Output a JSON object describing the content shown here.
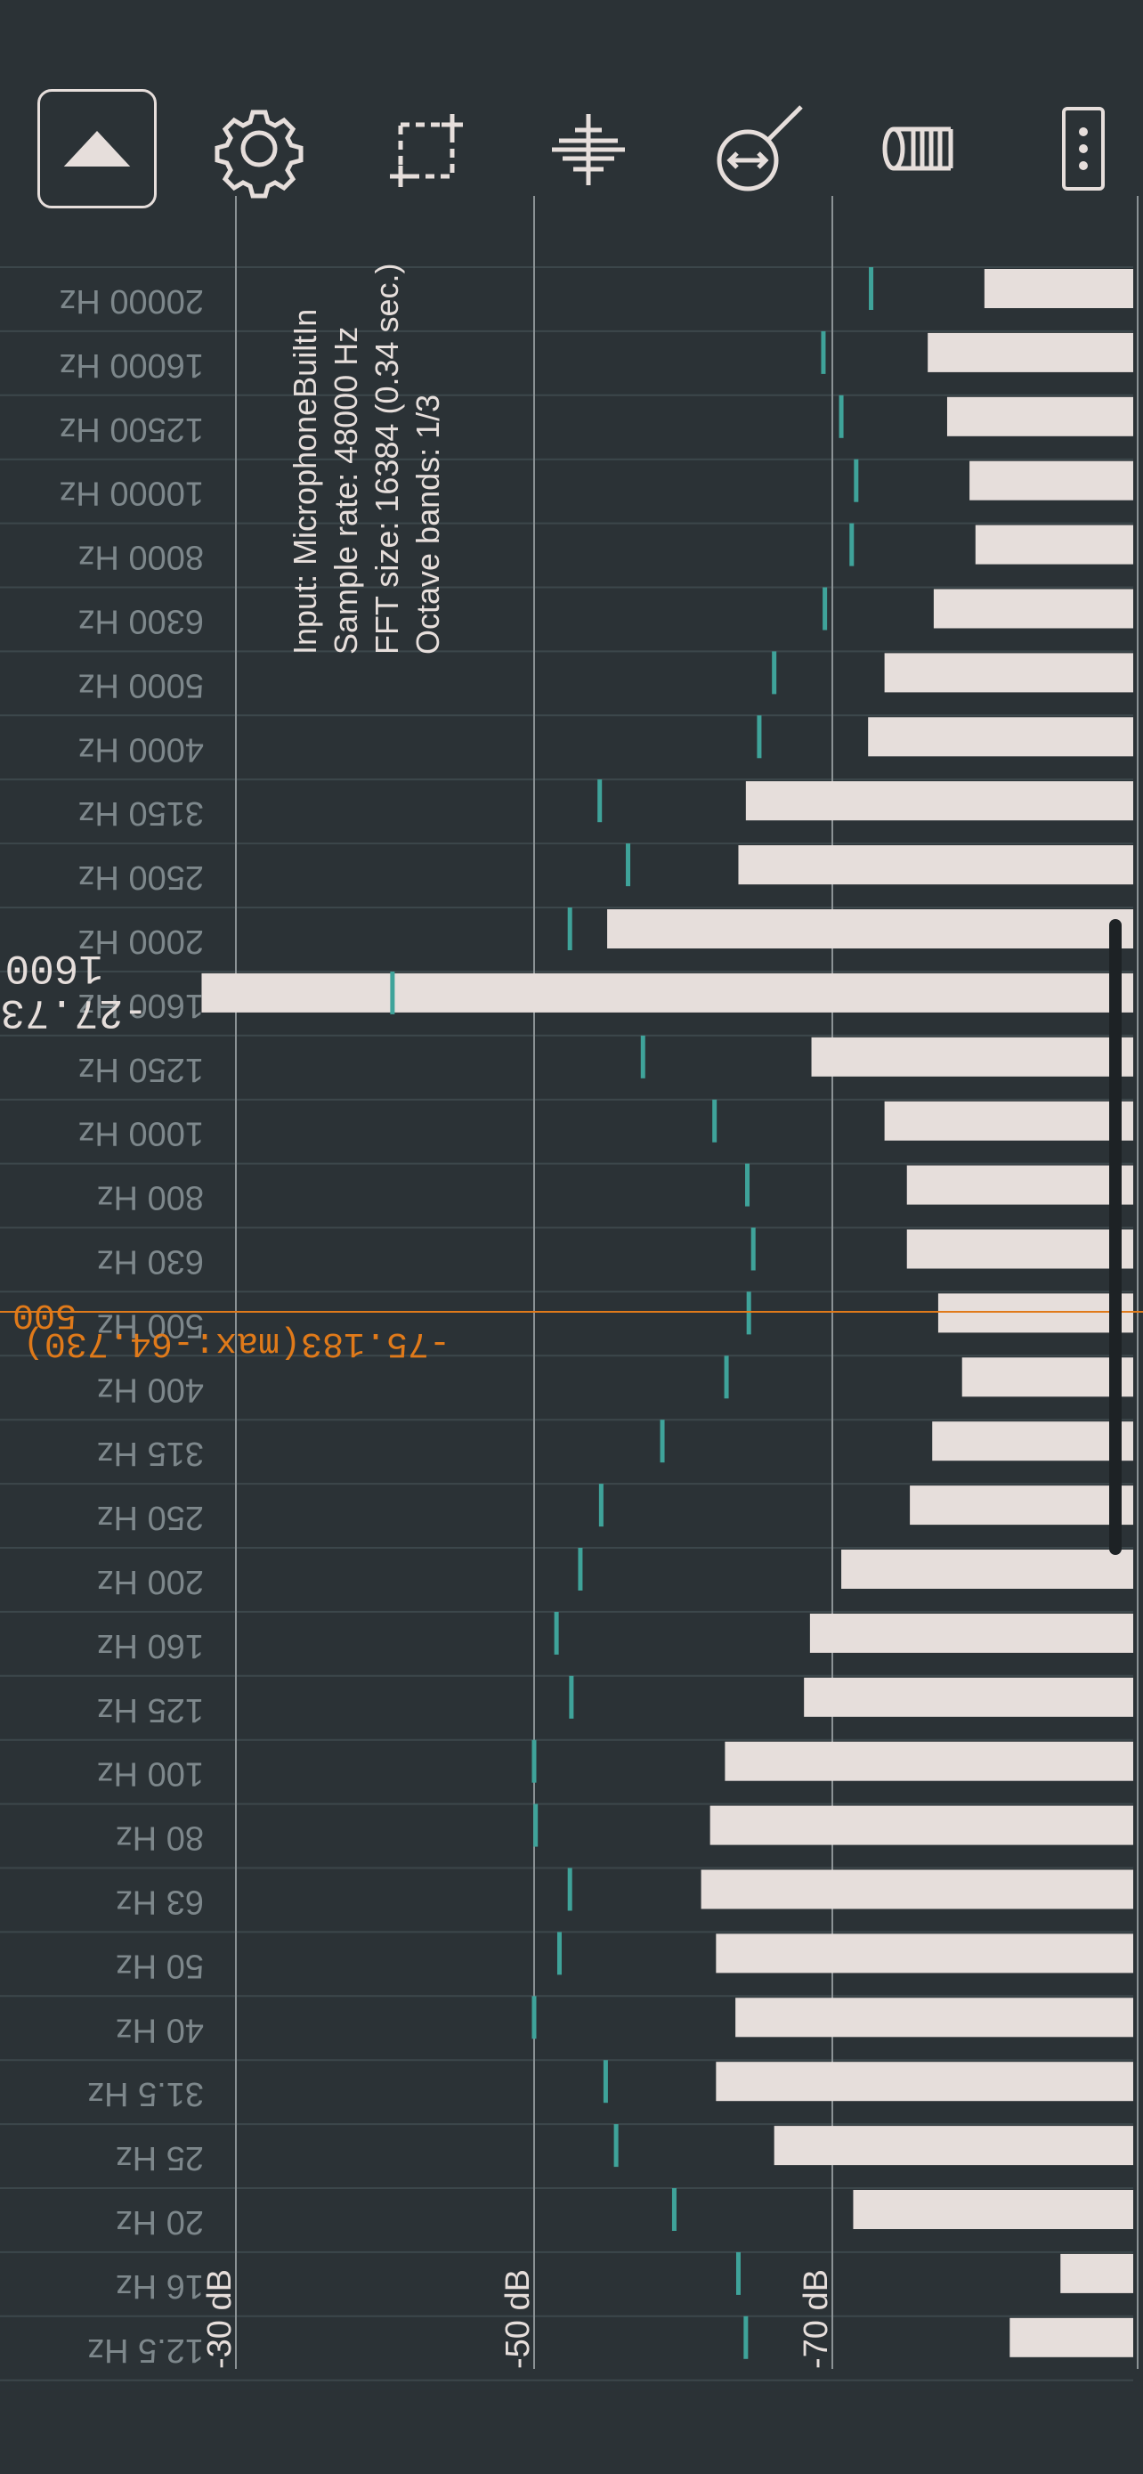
{
  "colors": {
    "background": "#2b3236",
    "bar": "#e6dedb",
    "peak_marker": "#3fa39a",
    "cursor": "#e07a1a",
    "text": "#e6dedb",
    "gridline": "#8b9295"
  },
  "toolbar": {
    "items": [
      {
        "icon": "triangle-up-icon"
      },
      {
        "icon": "gear-icon"
      },
      {
        "icon": "selection-box-icon"
      },
      {
        "icon": "waveform-icon"
      },
      {
        "icon": "magnifier-horizontal-icon"
      },
      {
        "icon": "cylinder-reset-icon"
      },
      {
        "icon": "more-vertical-icon"
      }
    ]
  },
  "info": {
    "input": "Input: MicrophoneBuiltIn",
    "sample_rate": "Sample rate: 48000 Hz",
    "fft_size": "FFT size: 16384 (0.34 sec.)",
    "octave_bands": "Octave bands: 1/3"
  },
  "cursor": {
    "value_text": "-75.183(max:-64.730)",
    "freq_text": "500",
    "band": "500 Hz"
  },
  "peak_readout": {
    "value_text": "-27.73",
    "freq_text": "1600"
  },
  "chart_data": {
    "type": "bar",
    "orientation": "horizontal",
    "title": "",
    "xlabel": "",
    "ylabel": "",
    "x_axis_ticks": [
      "-30 dB",
      "-50 dB",
      "-70 dB"
    ],
    "xlim": [
      -30,
      -90
    ],
    "categories": [
      "20000 Hz",
      "16000 Hz",
      "12500 Hz",
      "10000 Hz",
      "8000 Hz",
      "6300 Hz",
      "5000 Hz",
      "4000 Hz",
      "3150 Hz",
      "2500 Hz",
      "2000 Hz",
      "1600 Hz",
      "1250 Hz",
      "1000 Hz",
      "800 Hz",
      "630 Hz",
      "500 Hz",
      "400 Hz",
      "315 Hz",
      "250 Hz",
      "200 Hz",
      "160 Hz",
      "125 Hz",
      "100 Hz",
      "80 Hz",
      "63 Hz",
      "50 Hz",
      "40 Hz",
      "31.5 Hz",
      "25 Hz",
      "20 Hz",
      "16 Hz",
      "12.5 Hz"
    ],
    "series": [
      {
        "values": [
          -80.2,
          -76.4,
          -77.7,
          -79.2,
          -79.6,
          -76.8,
          -73.5,
          -72.4,
          -64.2,
          -63.7,
          -54.9,
          -27.7,
          -68.6,
          -73.5,
          -75.0,
          -75.0,
          -77.1,
          -78.7,
          -76.7,
          -75.2,
          -70.6,
          -68.5,
          -68.1,
          -62.8,
          -61.8,
          -61.2,
          -62.2,
          -63.5,
          -62.2,
          -66.1,
          -71.4,
          -85.3,
          -81.9
        ]
      },
      {
        "values": [
          -72.6,
          -69.4,
          -70.6,
          -71.6,
          -71.3,
          -69.5,
          -66.1,
          -65.1,
          -54.4,
          -56.3,
          -52.4,
          -40.5,
          -57.3,
          -62.1,
          -64.3,
          -64.7,
          -64.4,
          -62.9,
          -58.6,
          -54.5,
          -53.1,
          -51.5,
          -52.5,
          -50.0,
          -50.1,
          -52.4,
          -51.7,
          -50.0,
          -54.8,
          -55.5,
          -59.4,
          -63.7,
          -64.2
        ]
      }
    ],
    "grid": true,
    "legend": "none"
  }
}
